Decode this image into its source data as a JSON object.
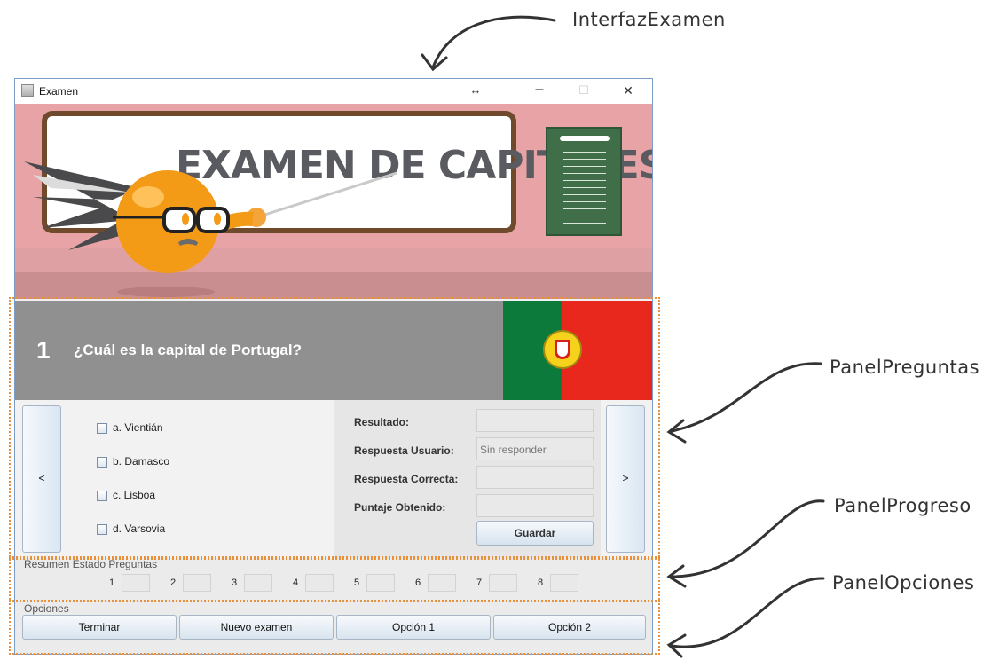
{
  "annotations": {
    "window": "InterfazExamen",
    "questions": "PanelPreguntas",
    "progress": "PanelProgreso",
    "options": "PanelOpciones"
  },
  "window": {
    "title": "Examen",
    "resize_glyph": "↔",
    "minimize": "–",
    "maximize": "☐",
    "close": "✕"
  },
  "banner": {
    "title": "EXAMEN DE CAPITALES"
  },
  "question": {
    "number": "1",
    "text": "¿Cuál es la capital de Portugal?",
    "flag_colors": {
      "green": "#0c7a3b",
      "red": "#e8281c"
    }
  },
  "nav": {
    "prev_label": "<",
    "next_label": ">"
  },
  "answers": [
    {
      "label": "a. Vientián",
      "checked": false
    },
    {
      "label": "b. Damasco",
      "checked": false
    },
    {
      "label": "c. Lisboa",
      "checked": false
    },
    {
      "label": "d. Varsovia",
      "checked": false
    }
  ],
  "results": {
    "resultado_label": "Resultado:",
    "resultado_value": "",
    "respuesta_usuario_label": "Respuesta Usuario:",
    "respuesta_usuario_value": "Sin responder",
    "respuesta_correcta_label": "Respuesta Correcta:",
    "respuesta_correcta_value": "",
    "puntaje_label": "Puntaje Obtenido:",
    "puntaje_value": "",
    "save_label": "Guardar"
  },
  "progress": {
    "legend": "Resumen Estado Preguntas",
    "items": [
      "1",
      "2",
      "3",
      "4",
      "5",
      "6",
      "7",
      "8"
    ]
  },
  "options": {
    "legend": "Opciones",
    "buttons": [
      "Terminar",
      "Nuevo examen",
      "Opción 1",
      "Opción 2"
    ]
  },
  "colors": {
    "annotation_dotted": "#e8913d",
    "question_bg": "#909090"
  }
}
